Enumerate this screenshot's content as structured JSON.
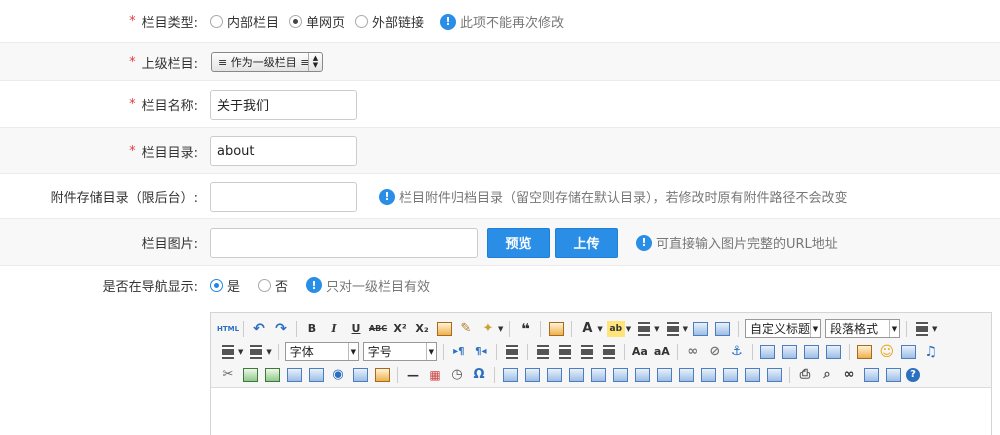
{
  "form": {
    "column_type": {
      "required_mark": "*",
      "label": "栏目类型:",
      "options": [
        "内部栏目",
        "单网页",
        "外部链接"
      ],
      "selected": "单网页",
      "tip": "此项不能再次修改"
    },
    "parent_column": {
      "required_mark": "*",
      "label": "上级栏目:",
      "value": "≡ 作为一级栏目 ≡"
    },
    "column_name": {
      "required_mark": "*",
      "label": "栏目名称:",
      "value": "关于我们"
    },
    "column_dir": {
      "required_mark": "*",
      "label": "栏目目录:",
      "value": "about"
    },
    "attach_dir": {
      "label": "附件存储目录（限后台）:",
      "value": "",
      "tip": "栏目附件归档目录（留空则存储在默认目录），若修改时原有附件路径不会改变"
    },
    "column_image": {
      "label": "栏目图片:",
      "value": "",
      "preview_label": "预览",
      "upload_label": "上传",
      "tip": "可直接输入图片完整的URL地址"
    },
    "nav_display": {
      "label": "是否在导航显示:",
      "options": [
        "是",
        "否"
      ],
      "selected": "是",
      "tip": "只对一级栏目有效"
    }
  },
  "editor": {
    "custom_title": "自定义标题",
    "paragraph_format": "段落格式",
    "font_family": "字体",
    "font_size": "字号"
  },
  "colors": {
    "accent": "#2b8ee6",
    "required": "#e4393c"
  }
}
